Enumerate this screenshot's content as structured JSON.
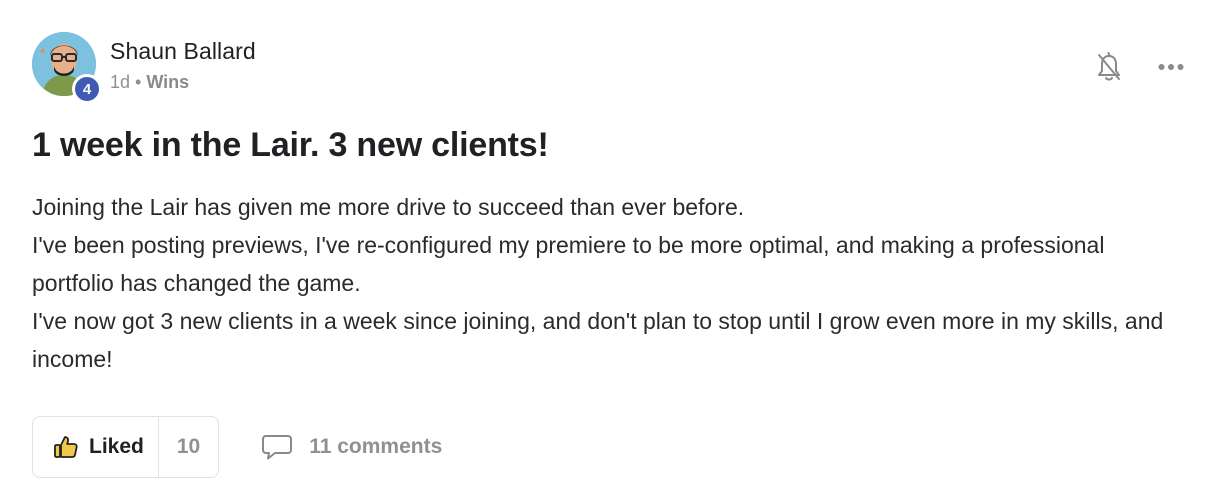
{
  "author": {
    "name": "Shaun Ballard",
    "level": "4",
    "avatar_icon": "avatar-icon"
  },
  "meta": {
    "time": "1d",
    "separator": "•",
    "category": "Wins"
  },
  "top_actions": {
    "notify_icon": "bell-off-icon",
    "more_icon": "more-horizontal-icon"
  },
  "post": {
    "title": "1 week in the Lair. 3 new clients!",
    "body": [
      "Joining the Lair has given me more drive to succeed than ever before.",
      "I've been posting previews, I've re-configured my premiere to be more optimal, and making a professional portfolio has changed the game.",
      "I've now got 3 new clients in a week since joining, and don't plan to stop until I grow even more in my skills, and income!"
    ]
  },
  "actions": {
    "like_label": "Liked",
    "like_count": "10",
    "comments_label": "11 comments",
    "like_icon": "thumbs-up-icon",
    "comment_icon": "comment-icon"
  },
  "colors": {
    "level_badge": "#3f5bb5",
    "like_icon_fill": "#f2c84b",
    "muted_text": "#909090",
    "border": "#e2e2e2"
  }
}
